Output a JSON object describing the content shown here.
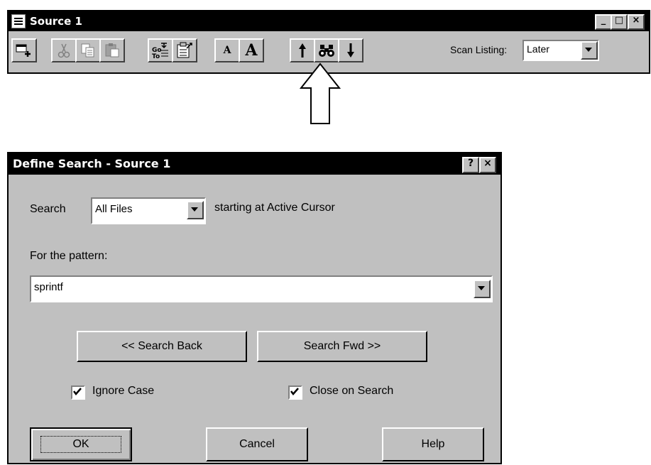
{
  "source_window": {
    "title": "Source 1",
    "controls": {
      "minimize": "_",
      "maximize": "□",
      "close": "×"
    },
    "toolbar": {
      "buttons": [
        "new-window-icon",
        "cut-icon",
        "copy-icon",
        "paste-icon",
        "goto-icon",
        "properties-icon",
        "font-smaller-icon",
        "font-larger-icon",
        "search-up-icon",
        "binoculars-icon",
        "search-down-icon"
      ],
      "font_small_glyph": "A",
      "font_large_glyph": "A",
      "goto_text_top": "Go",
      "goto_text_bottom": "To",
      "scan_listing_label": "Scan Listing:",
      "scan_listing_value": "Later"
    }
  },
  "callout": "arrow-up-outline",
  "dialog": {
    "title": "Define Search - Source 1",
    "help_glyph": "?",
    "close_glyph": "×",
    "search_label": "Search",
    "search_scope_value": "All Files",
    "starting_at": "starting at Active Cursor",
    "pattern_label": "For the pattern:",
    "pattern_value": "sprintf",
    "search_back_label": "<< Search Back",
    "search_fwd_label": "Search Fwd >>",
    "ignore_case_label": "Ignore Case",
    "ignore_case_checked": true,
    "close_on_search_label": "Close on Search",
    "close_on_search_checked": true,
    "ok_label": "OK",
    "cancel_label": "Cancel",
    "help_label": "Help"
  },
  "colors": {
    "face": "#c0c0c0",
    "title_bar": "#000000",
    "title_text": "#ffffff",
    "field_bg": "#ffffff"
  }
}
